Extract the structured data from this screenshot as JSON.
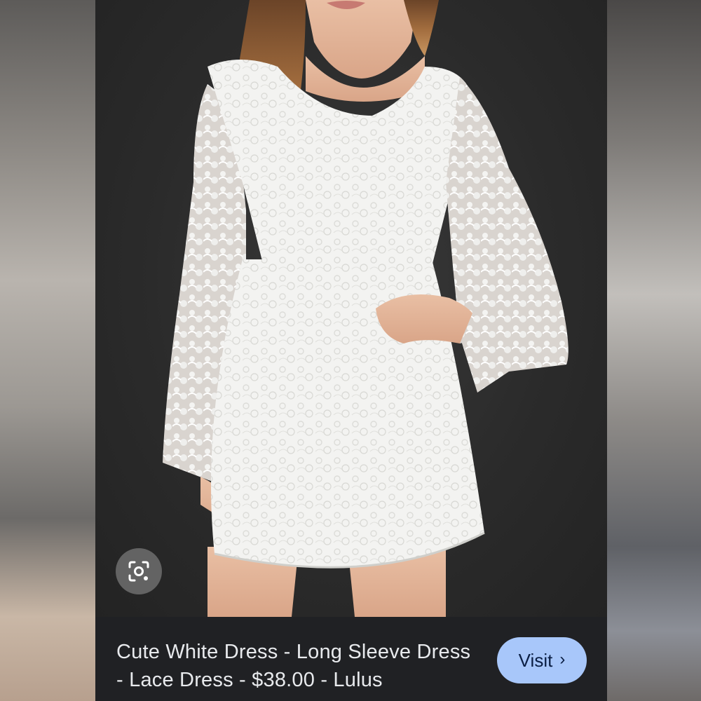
{
  "result": {
    "title": "Cute White Dress - Long Sleeve Dress - Lace Dress - $38.00 - Lulus",
    "visit_label": "Visit",
    "visit_icon": "chevron-right-icon"
  },
  "image": {
    "description_icon": "lens-icon",
    "colors": {
      "background": "#2b2b2b",
      "dress": "#f4f4f2",
      "caption_bar": "#202124",
      "visit_button": "#a8c7fa"
    }
  }
}
